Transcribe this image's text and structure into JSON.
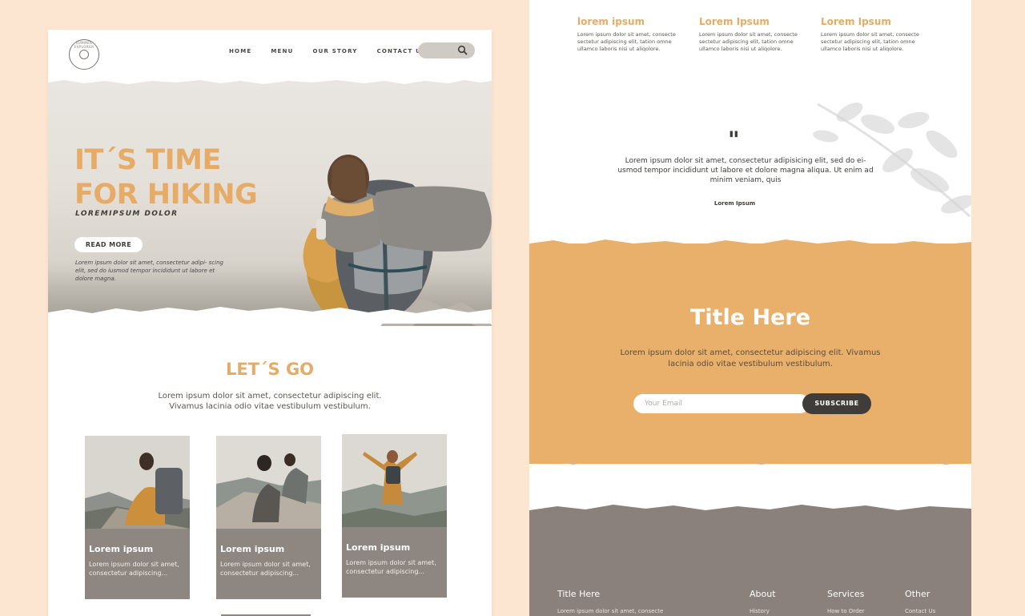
{
  "left": {
    "logo_text": "SUMMER EXPLORER",
    "nav": [
      "HOME",
      "MENU",
      "OUR STORY",
      "CONTACT US"
    ],
    "hero": {
      "title_line1": "IT´S TIME",
      "title_line2": "FOR HIKING",
      "subtitle": "LOREMIPSUM DOLOR",
      "button": "READ MORE",
      "desc": "Lorem ipsum dolor sit amet, consectetur adipi- scing elit, sed do iusmod tempor incididunt ut labore et dolore magna."
    },
    "section": {
      "title": "LET´S GO",
      "desc": "Lorem ipsum dolor sit amet, consectetur adipiscing elit. Vivamus lacinia odio vitae vestibulum vestibulum."
    },
    "cards": [
      {
        "title": "Lorem ipsum",
        "text": "Lorem ipsum dolor sit amet, consectetur adipiscing..."
      },
      {
        "title": "Lorem ipsum",
        "text": "Lorem ipsum dolor sit amet, consectetur adipiscing..."
      },
      {
        "title": "Lorem ipsum",
        "text": "Lorem ipsum dolor sit amet, consectetur adipiscing..."
      }
    ]
  },
  "right": {
    "columns": [
      {
        "title": "lorem ipsum",
        "text": "Lorem ipsum dolor sit amet, consecte sectetur adipiscing elit, tation omne ullamco laboris nisi ut aliqolore."
      },
      {
        "title": "Lorem Ipsum",
        "text": "Lorem ipsum dolor sit amet, consecte sectetur adipiscing elit, tation omne ullamco laboris nisi ut aliqolore."
      },
      {
        "title": "Lorem Ipsum",
        "text": "Lorem ipsum dolor sit amet, consecte sectetur adipiscing elit, tation omne ullamco laboris nisi ut aliqolore."
      }
    ],
    "quote": {
      "mark": "\"",
      "text": "Lorem ipsum dolor sit amet, consectetur adipisicing elit, sed do ei- usmod tempor incididunt ut labore et dolore magna aliqua. Ut enim ad minim veniam, quis",
      "author": "Lorem Ipsum"
    },
    "band": {
      "title": "Title Here",
      "desc": "Lorem ipsum dolor sit amet, consectetur adipiscing elit. Vivamus lacinia odio vitae vestibulum vestibulum.",
      "email_placeholder": "Your Email",
      "subscribe": "SUBSCRIBE"
    },
    "footer": {
      "title": "Title Here",
      "title_text": "Lorem ipsum dolor sit amet, consecte",
      "cols": [
        {
          "title": "About",
          "link": "History"
        },
        {
          "title": "Services",
          "link": "How to Order"
        },
        {
          "title": "Other",
          "link": "Contact Us"
        }
      ]
    }
  },
  "colors": {
    "background": "#fde6d1",
    "accent_orange": "#e6ac67",
    "band_orange": "#e8b06b",
    "footer_gray": "#8a817c",
    "dark": "#3f3c39"
  }
}
